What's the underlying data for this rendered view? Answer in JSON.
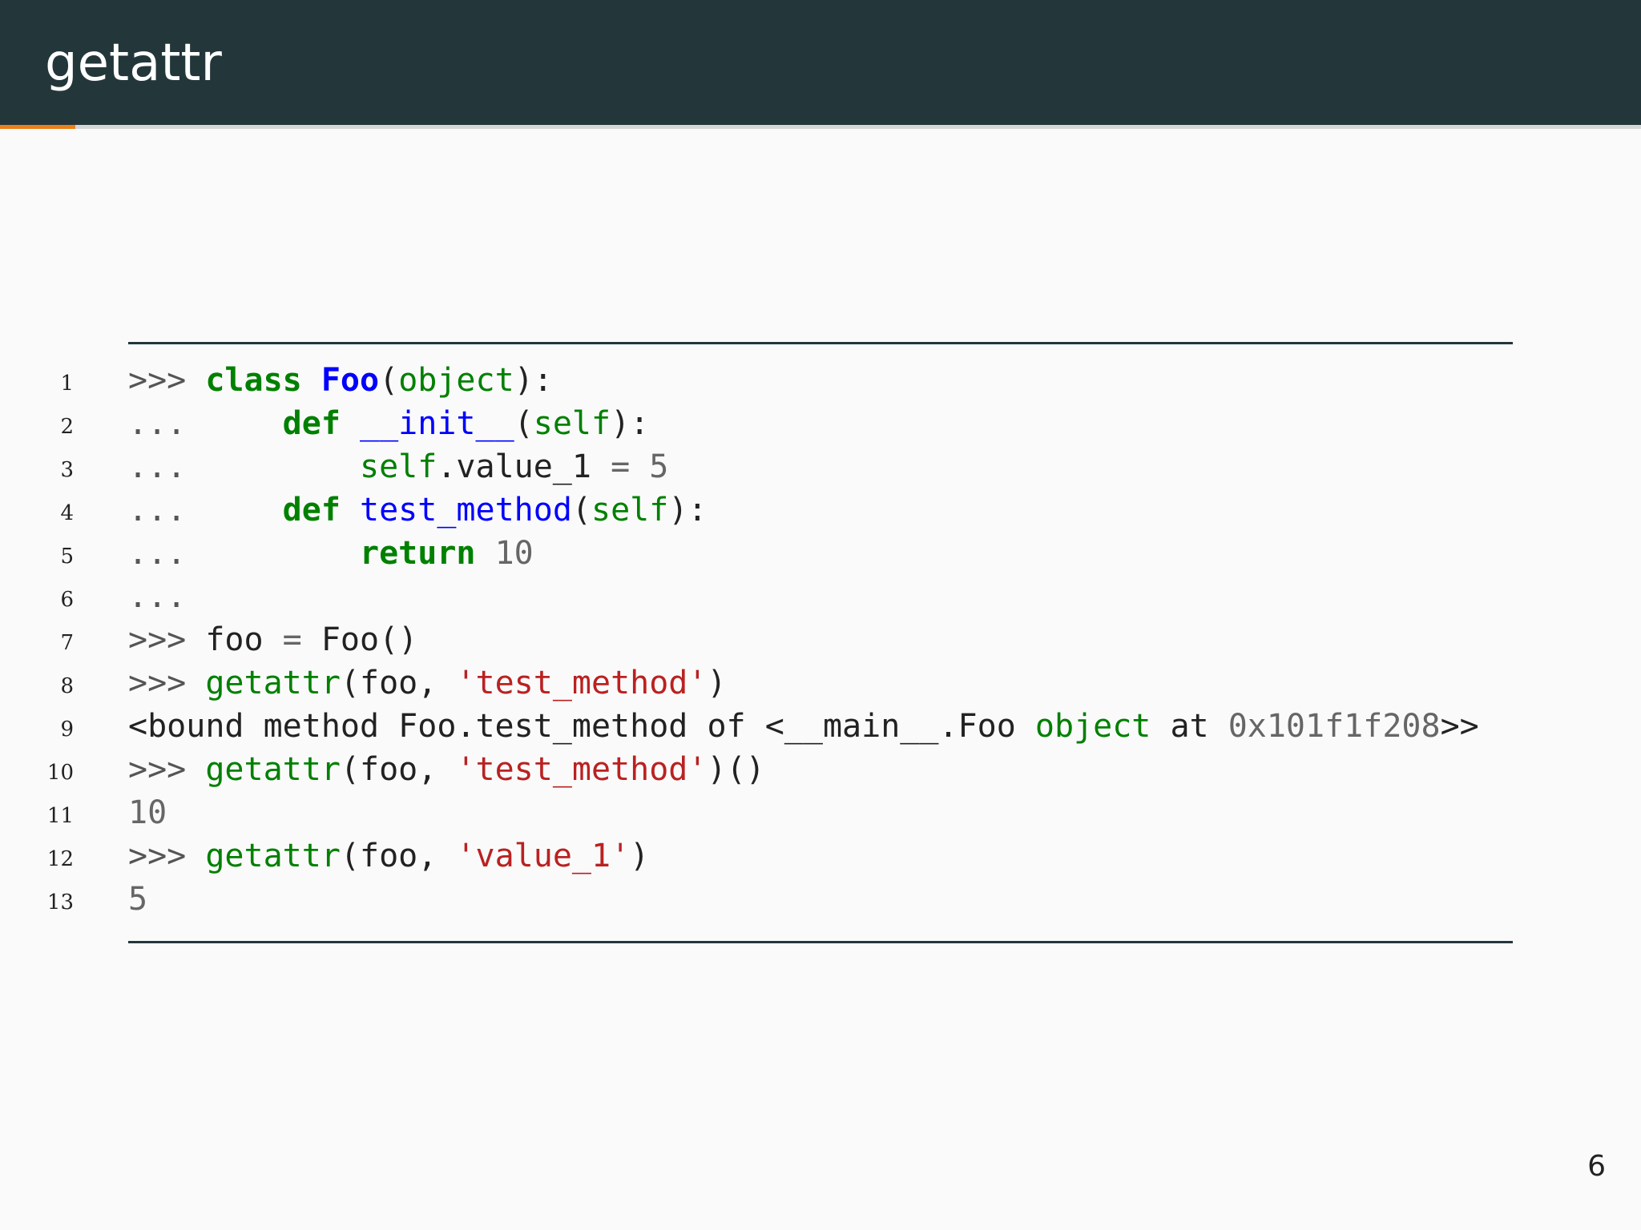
{
  "slide": {
    "title": "getattr",
    "page_number": "6",
    "progress": 0.046
  },
  "code": {
    "language": "python",
    "lines": [
      {
        "n": "1",
        "tokens": [
          {
            "t": ">>> ",
            "c": "prompt"
          },
          {
            "t": "class",
            "c": "kw"
          },
          {
            "t": " "
          },
          {
            "t": "Foo",
            "c": "cls"
          },
          {
            "t": "("
          },
          {
            "t": "object",
            "c": "bi"
          },
          {
            "t": "):"
          }
        ]
      },
      {
        "n": "2",
        "tokens": [
          {
            "t": "...     ",
            "c": "prompt"
          },
          {
            "t": "def",
            "c": "kw"
          },
          {
            "t": " "
          },
          {
            "t": "__init__",
            "c": "fn"
          },
          {
            "t": "("
          },
          {
            "t": "self",
            "c": "bi"
          },
          {
            "t": "):"
          }
        ]
      },
      {
        "n": "3",
        "tokens": [
          {
            "t": "...         ",
            "c": "prompt"
          },
          {
            "t": "self",
            "c": "bi"
          },
          {
            "t": ".value_1 "
          },
          {
            "t": "=",
            "c": "op"
          },
          {
            "t": " "
          },
          {
            "t": "5",
            "c": "num"
          }
        ]
      },
      {
        "n": "4",
        "tokens": [
          {
            "t": "...     ",
            "c": "prompt"
          },
          {
            "t": "def",
            "c": "kw"
          },
          {
            "t": " "
          },
          {
            "t": "test_method",
            "c": "fn"
          },
          {
            "t": "("
          },
          {
            "t": "self",
            "c": "bi"
          },
          {
            "t": "):"
          }
        ]
      },
      {
        "n": "5",
        "tokens": [
          {
            "t": "...         ",
            "c": "prompt"
          },
          {
            "t": "return",
            "c": "kw"
          },
          {
            "t": " "
          },
          {
            "t": "10",
            "c": "num"
          }
        ]
      },
      {
        "n": "6",
        "tokens": [
          {
            "t": "...",
            "c": "prompt"
          }
        ]
      },
      {
        "n": "7",
        "tokens": [
          {
            "t": ">>> ",
            "c": "prompt"
          },
          {
            "t": "foo "
          },
          {
            "t": "=",
            "c": "op"
          },
          {
            "t": " Foo()"
          }
        ]
      },
      {
        "n": "8",
        "tokens": [
          {
            "t": ">>> ",
            "c": "prompt"
          },
          {
            "t": "getattr",
            "c": "bi"
          },
          {
            "t": "(foo, "
          },
          {
            "t": "'test_method'",
            "c": "str"
          },
          {
            "t": ")"
          }
        ]
      },
      {
        "n": "9",
        "tokens": [
          {
            "t": "<bound method Foo.test_method of <__main__.Foo "
          },
          {
            "t": "object",
            "c": "bi"
          },
          {
            "t": " at "
          },
          {
            "t": "0x101f1f208",
            "c": "num"
          },
          {
            "t": ">>"
          }
        ]
      },
      {
        "n": "10",
        "tokens": [
          {
            "t": ">>> ",
            "c": "prompt"
          },
          {
            "t": "getattr",
            "c": "bi"
          },
          {
            "t": "(foo, "
          },
          {
            "t": "'test_method'",
            "c": "str"
          },
          {
            "t": ")()"
          }
        ]
      },
      {
        "n": "11",
        "tokens": [
          {
            "t": "10",
            "c": "num"
          }
        ]
      },
      {
        "n": "12",
        "tokens": [
          {
            "t": ">>> ",
            "c": "prompt"
          },
          {
            "t": "getattr",
            "c": "bi"
          },
          {
            "t": "(foo, "
          },
          {
            "t": "'value_1'",
            "c": "str"
          },
          {
            "t": ")"
          }
        ]
      },
      {
        "n": "13",
        "tokens": [
          {
            "t": "5",
            "c": "num"
          }
        ]
      }
    ]
  },
  "colors": {
    "header_bg": "#23373b",
    "accent": "#eb811b",
    "page_bg": "#fafafa"
  }
}
